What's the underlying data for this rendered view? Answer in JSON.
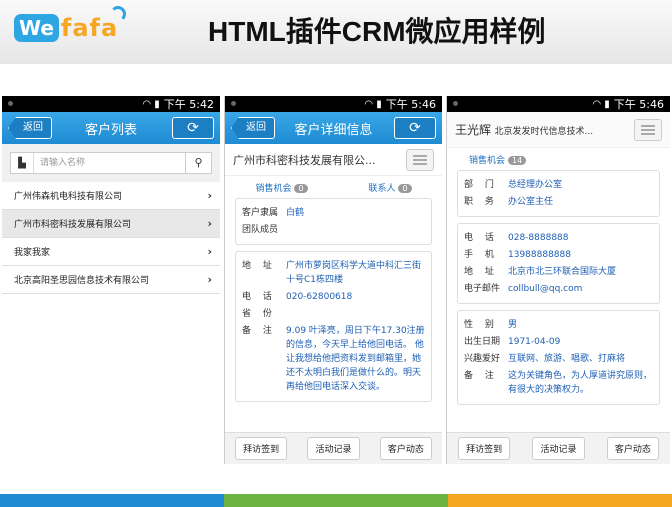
{
  "slide": {
    "logo_we": "We",
    "logo_fafa": "fafa",
    "title": "HTML插件CRM微应用样例",
    "bottom_colors": [
      "#1e8bd3",
      "#6db33f",
      "#f5a623"
    ]
  },
  "phone1": {
    "time": "下午 5:42",
    "back": "返回",
    "title": "客户列表",
    "search_placeholder": "请输入名称",
    "items": [
      {
        "label": "广州伟森机电科技有限公司"
      },
      {
        "label": "广州市科密科技发展有限公司"
      },
      {
        "label": "我家我家"
      },
      {
        "label": "北京高阳圣思园信息技术有限公司"
      }
    ]
  },
  "phone2": {
    "time": "下午 5:46",
    "back": "返回",
    "title": "客户详细信息",
    "company": "广州市科密科技发展有限公...",
    "tab1": "销售机会",
    "tab1_count": "0",
    "tab2": "联系人",
    "tab2_count": "0",
    "card1": [
      {
        "k": "客户隶属",
        "v": "白鹤"
      },
      {
        "k": "团队成员",
        "v": ""
      }
    ],
    "card2": [
      {
        "k": "地　 址",
        "v": "广州市萝岗区科学大道中科汇三街十号C1栋四楼"
      },
      {
        "k": "电　 话",
        "v": "020-62800618"
      },
      {
        "k": "省　 份",
        "v": ""
      },
      {
        "k": "备　 注",
        "v": "9.09 叶泽亮，周日下午17.30注册的信息，今天早上给他回电话。 他让我想给他把资料发到邮箱里，她还不太明白我们是做什么的。明天再给他回电话深入交谈。"
      }
    ],
    "footer": [
      "拜访签到",
      "活动记录",
      "客户动态"
    ]
  },
  "phone3": {
    "time": "下午 5:46",
    "name": "王光辉",
    "company": "北京发发时代信息技术...",
    "tab1": "销售机会",
    "tab1_count": "14",
    "card1": [
      {
        "k": "部　 门",
        "v": "总经理办公室"
      },
      {
        "k": "职　 务",
        "v": "办公室主任"
      }
    ],
    "card2": [
      {
        "k": "电　 话",
        "v": "028-8888888"
      },
      {
        "k": "手　 机",
        "v": "13988888888"
      },
      {
        "k": "地　 址",
        "v": "北京市北三环联合国际大厦"
      },
      {
        "k": "电子邮件",
        "v": "collbull@qq.com"
      }
    ],
    "card3": [
      {
        "k": "性　 别",
        "v": "男"
      },
      {
        "k": "出生日期",
        "v": "1971-04-09"
      },
      {
        "k": "兴趣爱好",
        "v": "互联网、旅游、唱歌、打麻将"
      },
      {
        "k": "备　 注",
        "v": "这为关键角色，为人厚道讲究原则，有很大的决策权力。"
      }
    ],
    "footer": [
      "拜访签到",
      "活动记录",
      "客户动态"
    ]
  }
}
